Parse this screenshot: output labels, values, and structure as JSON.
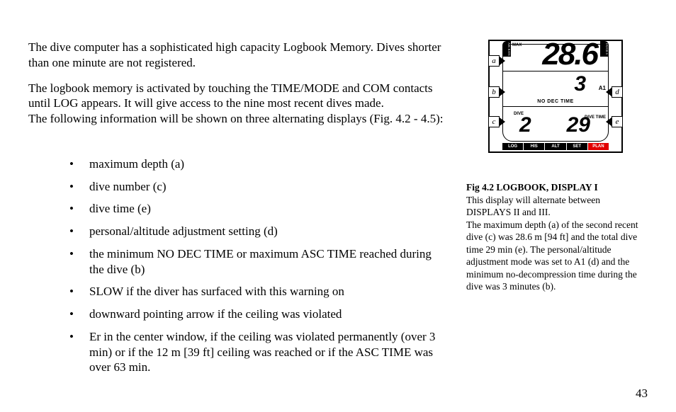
{
  "page_number": "43",
  "main": {
    "p1": "The dive computer has a sophisticated high capacity Logbook Memory. Dives shorter than one minute are not registered.",
    "p2a": "The logbook memory is activated by touching the TIME/MODE and COM contacts until LOG appears. It will give access to the nine most recent dives made.",
    "p2b": "The following information will be shown on three alternating displays (Fig. 4.2 - 4.5):",
    "bullets": [
      "maximum depth (a)",
      "dive number (c)",
      "dive time (e)",
      "personal/altitude adjustment setting (d)",
      "the minimum NO DEC TIME or maximum ASC TIME reached during the dive (b)",
      "SLOW if the diver has surfaced with this warning on",
      "downward pointing arrow if the ceiling was violated",
      "Er in the center window, if the ceiling was violated permanently (over 3 min) or if the 12 m [39 ft] ceiling was reached or if the ASC TIME was over 63 min."
    ]
  },
  "figure": {
    "callouts": {
      "a": "a",
      "b": "b",
      "c": "c",
      "d": "d",
      "e": "e"
    },
    "lcd": {
      "left_col": "ASC RATE",
      "right_col": "FAVOR S",
      "max_label": "MAX",
      "max_depth": "28.6",
      "mid_value": "3",
      "a1_label": "A1",
      "no_dec": "NO DEC TIME",
      "dive_label_c": "DIVE",
      "dive_label_e": "DIVE\nTIME",
      "dive_number": "2",
      "dive_time": "29",
      "modes": [
        "LOG",
        "HIS",
        "ALT",
        "SET",
        "PLAN"
      ],
      "mode_selected_index": 4
    },
    "caption_title": "Fig 4.2 LOGBOOK, DISPLAY I",
    "caption_body": "This display will alternate between DISPLAYS II and III.\nThe maximum depth (a) of the second recent dive (c) was 28.6 m [94 ft] and the total dive time 29 min (e). The personal/altitude adjustment mode was set to A1 (d) and the minimum no-decompression time during the dive was 3 minutes (b)."
  }
}
